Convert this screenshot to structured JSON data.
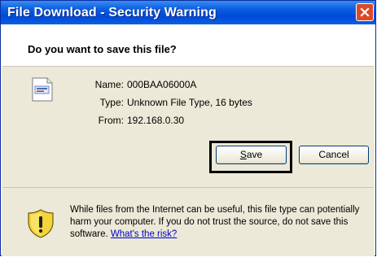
{
  "window": {
    "title": "File Download - Security Warning",
    "close_icon": "close-icon"
  },
  "prompt": {
    "question": "Do you want to save this file?"
  },
  "file": {
    "icon": "file-icon",
    "name_label": "Name:",
    "name_value": "000BAA06000A",
    "type_label": "Type:",
    "type_value": "Unknown File Type, 16 bytes",
    "from_label": "From:",
    "from_value": "192.168.0.30"
  },
  "buttons": {
    "save_label_mnemonic": "S",
    "save_label_rest": "ave",
    "cancel_label": "Cancel"
  },
  "warning": {
    "icon": "shield-warning-icon",
    "text": "While files from the Internet can be useful, this file type can potentially harm your computer. If you do not trust the source, do not save this software.",
    "link_text": "What's the risk?"
  },
  "colors": {
    "titlebar": "#0a5fe0",
    "body": "#ece9d8",
    "close_button": "#d84a2a",
    "link": "#0000cc",
    "highlight_border": "#000000"
  }
}
